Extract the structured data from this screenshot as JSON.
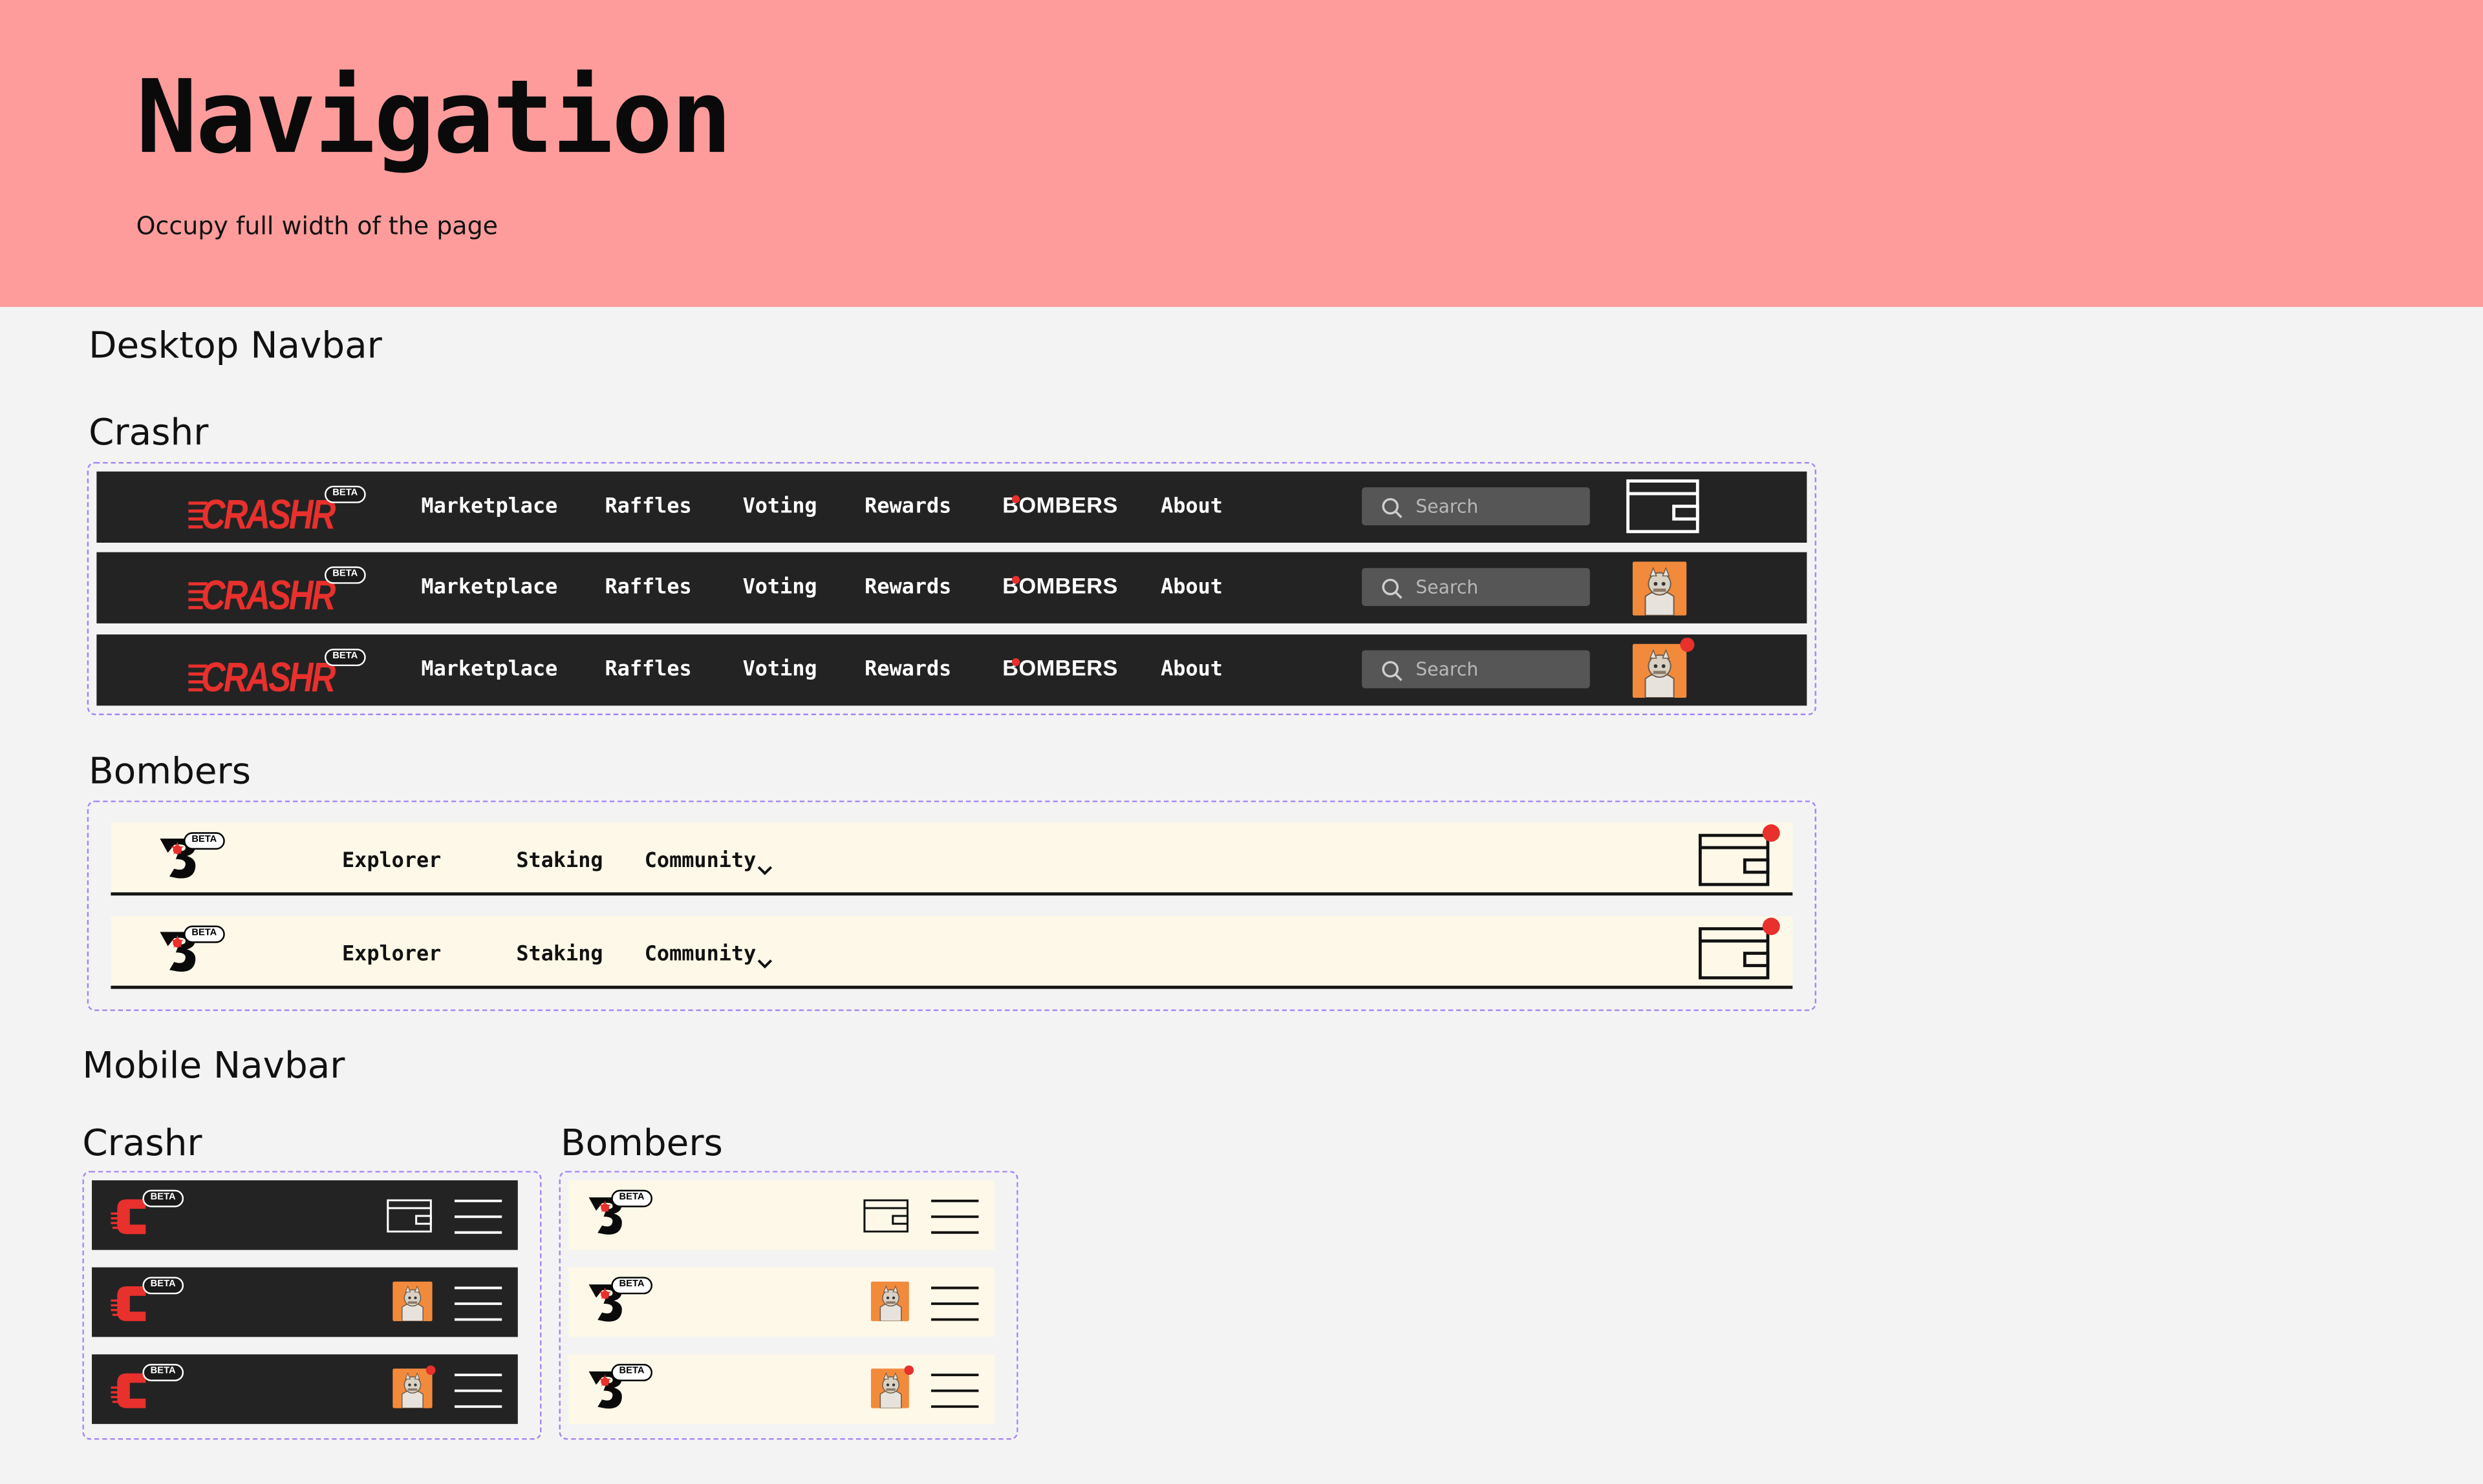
{
  "header": {
    "title": "Navigation",
    "subtitle": "Occupy full width of the page"
  },
  "sections": {
    "desktop": "Desktop Navbar",
    "mobile": "Mobile Navbar"
  },
  "groups": {
    "crashr": "Crashr",
    "bombers": "Bombers"
  },
  "crashr_nav": {
    "brand": "CRASHR",
    "beta": "BETA",
    "links": [
      "Marketplace",
      "Raffles",
      "Voting",
      "Rewards",
      "About"
    ],
    "bombers_link": "BOMBERS",
    "search_placeholder": "Search"
  },
  "bombers_nav": {
    "beta": "BETA",
    "links": [
      "Explorer",
      "Staking",
      "Community"
    ]
  },
  "colors": {
    "hero": "#fe9c9c",
    "dark_nav": "#232323",
    "light_nav": "#fdf8e8",
    "accent_red": "#e8302d",
    "avatar_orange": "#f28a3c",
    "frame_dash": "#a584f5"
  },
  "icons": [
    "search-icon",
    "wallet-icon",
    "avatar-icon",
    "hamburger-icon",
    "chevron-down-icon",
    "notification-dot-icon"
  ]
}
